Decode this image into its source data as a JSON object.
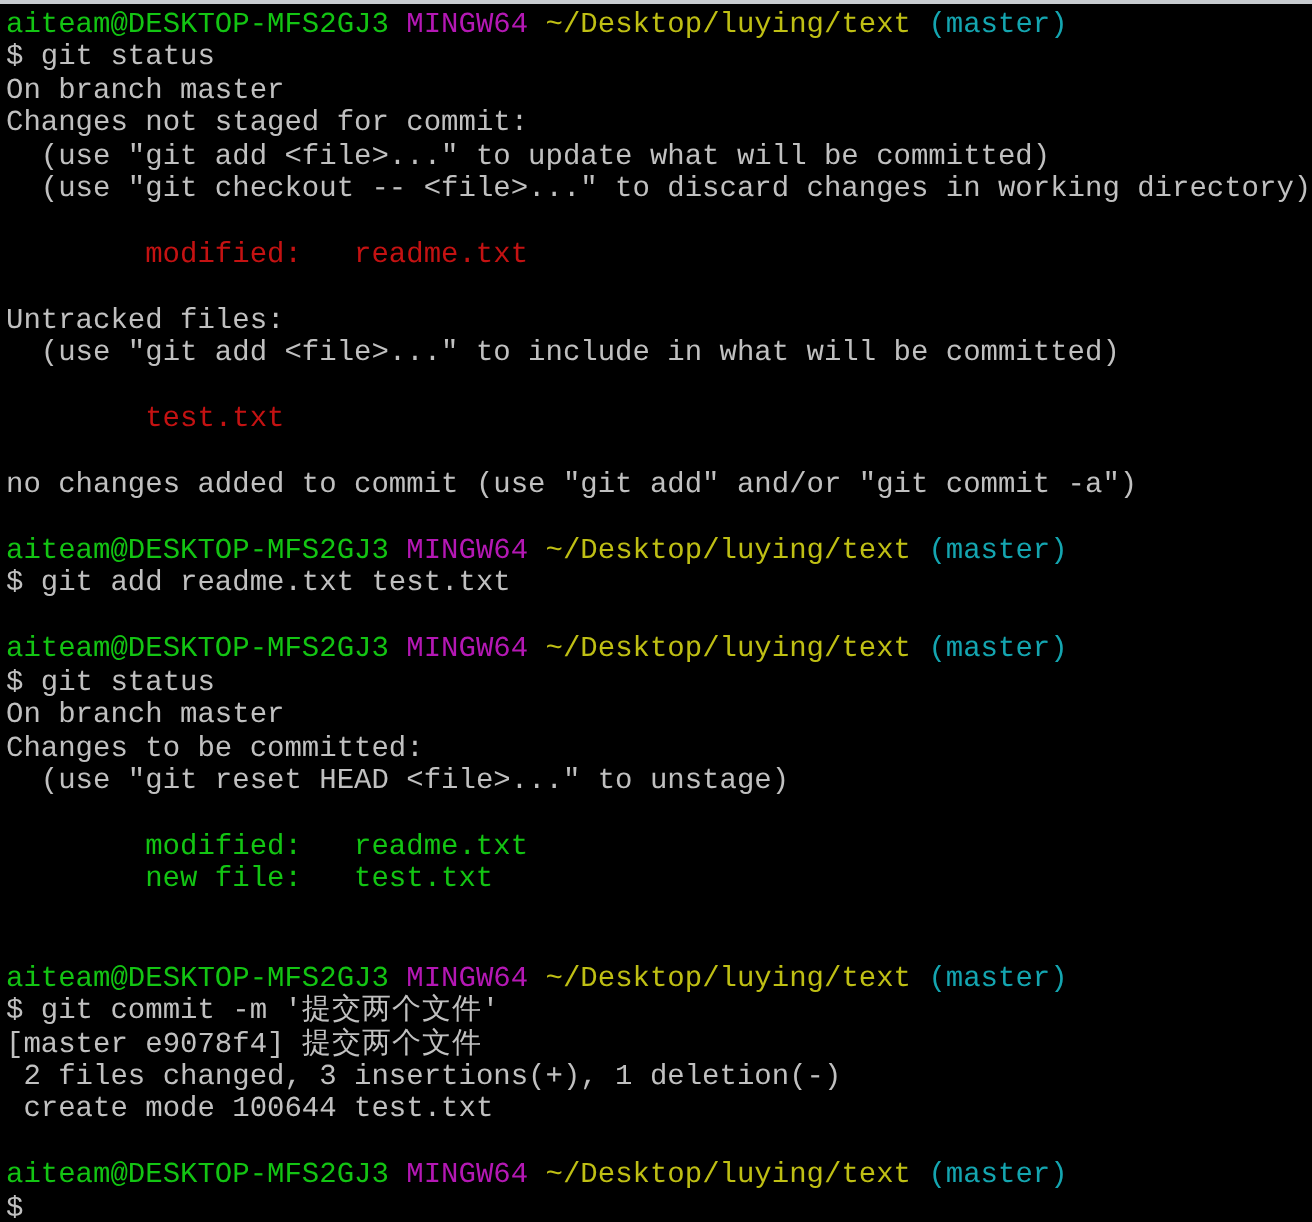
{
  "terminal": {
    "lines": [
      {
        "kind": "prompt",
        "user": "aiteam@DESKTOP-MFS2GJ3",
        "shell": "MINGW64",
        "path": "~/Desktop/luying/text",
        "branch": "(master)"
      },
      {
        "kind": "command",
        "text": "$ git status"
      },
      {
        "kind": "output",
        "text": "On branch master"
      },
      {
        "kind": "output",
        "text": "Changes not staged for commit:"
      },
      {
        "kind": "output",
        "text": "  (use \"git add <file>...\" to update what will be committed)"
      },
      {
        "kind": "output",
        "text": "  (use \"git checkout -- <file>...\" to discard changes in working directory)"
      },
      {
        "kind": "blank"
      },
      {
        "kind": "unstaged",
        "text": "modified:   readme.txt"
      },
      {
        "kind": "blank"
      },
      {
        "kind": "output",
        "text": "Untracked files:"
      },
      {
        "kind": "output",
        "text": "  (use \"git add <file>...\" to include in what will be committed)"
      },
      {
        "kind": "blank"
      },
      {
        "kind": "unstaged",
        "text": "test.txt"
      },
      {
        "kind": "blank"
      },
      {
        "kind": "output",
        "text": "no changes added to commit (use \"git add\" and/or \"git commit -a\")"
      },
      {
        "kind": "blank"
      },
      {
        "kind": "prompt",
        "user": "aiteam@DESKTOP-MFS2GJ3",
        "shell": "MINGW64",
        "path": "~/Desktop/luying/text",
        "branch": "(master)"
      },
      {
        "kind": "command",
        "text": "$ git add readme.txt test.txt"
      },
      {
        "kind": "blank"
      },
      {
        "kind": "prompt",
        "user": "aiteam@DESKTOP-MFS2GJ3",
        "shell": "MINGW64",
        "path": "~/Desktop/luying/text",
        "branch": "(master)"
      },
      {
        "kind": "command",
        "text": "$ git status"
      },
      {
        "kind": "output",
        "text": "On branch master"
      },
      {
        "kind": "output",
        "text": "Changes to be committed:"
      },
      {
        "kind": "output",
        "text": "  (use \"git reset HEAD <file>...\" to unstage)"
      },
      {
        "kind": "blank"
      },
      {
        "kind": "staged",
        "text": "modified:   readme.txt"
      },
      {
        "kind": "staged",
        "text": "new file:   test.txt"
      },
      {
        "kind": "blank"
      },
      {
        "kind": "blank"
      },
      {
        "kind": "prompt",
        "user": "aiteam@DESKTOP-MFS2GJ3",
        "shell": "MINGW64",
        "path": "~/Desktop/luying/text",
        "branch": "(master)"
      },
      {
        "kind": "command",
        "text": "$ git commit -m '提交两个文件'"
      },
      {
        "kind": "output",
        "text": "[master e9078f4] 提交两个文件"
      },
      {
        "kind": "output",
        "text": " 2 files changed, 3 insertions(+), 1 deletion(-)"
      },
      {
        "kind": "output",
        "text": " create mode 100644 test.txt"
      },
      {
        "kind": "blank"
      },
      {
        "kind": "prompt",
        "user": "aiteam@DESKTOP-MFS2GJ3",
        "shell": "MINGW64",
        "path": "~/Desktop/luying/text",
        "branch": "(master)"
      },
      {
        "kind": "command",
        "text": "$"
      }
    ]
  }
}
